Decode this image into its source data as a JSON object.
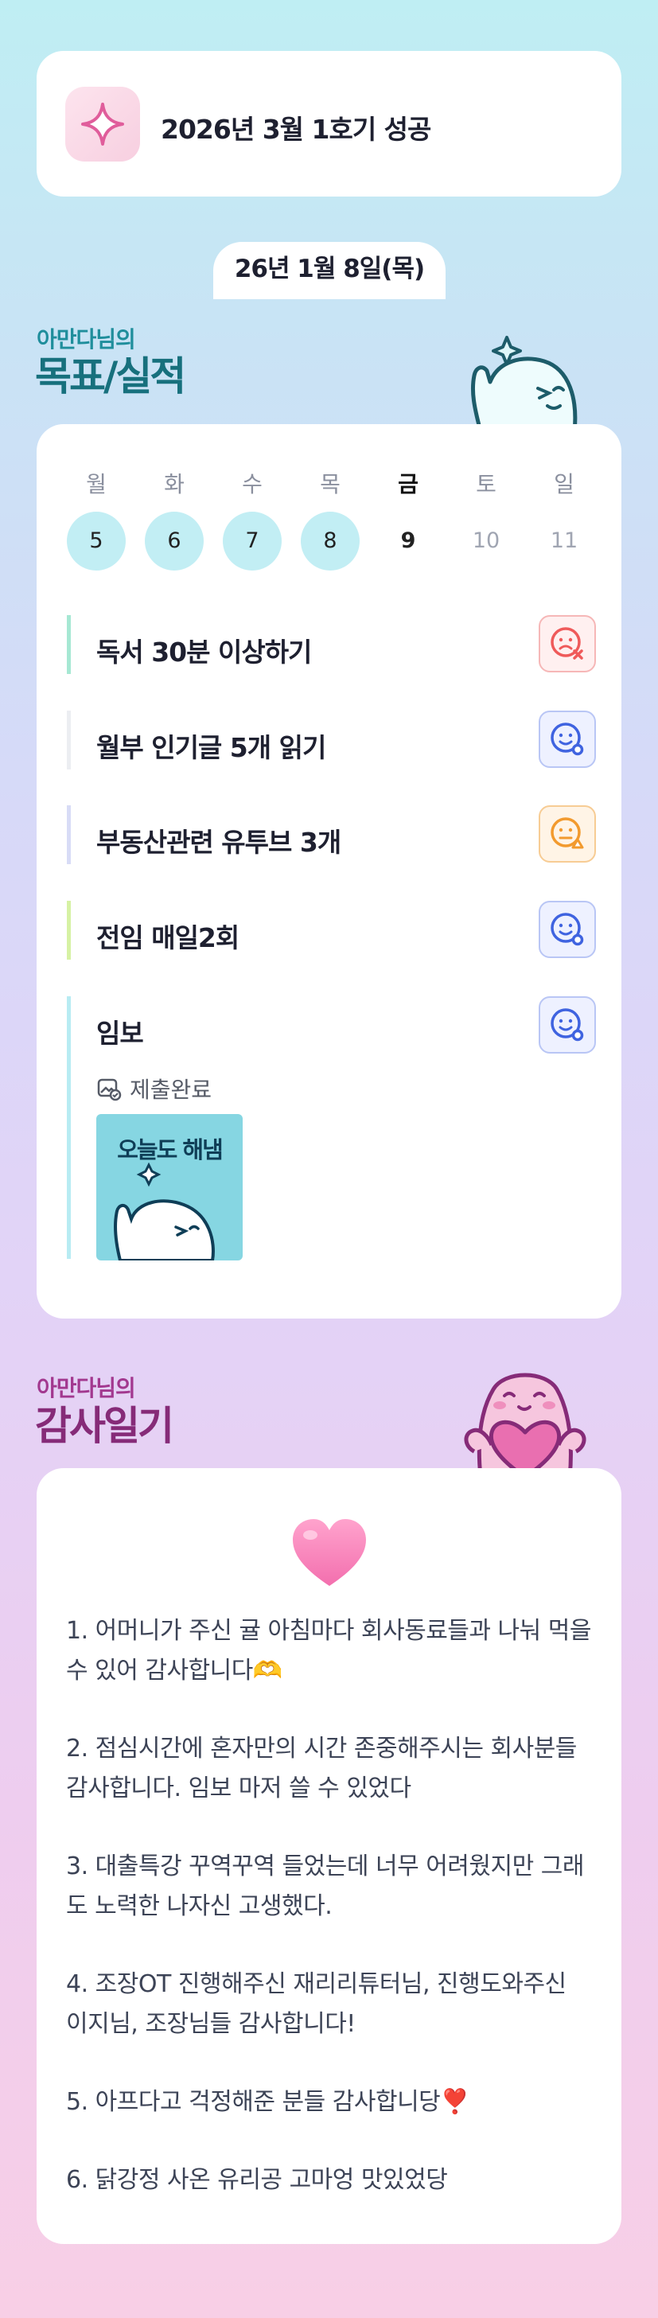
{
  "header": {
    "title": "2026년 3월 1호기 성공",
    "icon": "sparkle-icon"
  },
  "date_label": "26년 1월 8일(목)",
  "goals": {
    "owner_label": "아만다님의",
    "title": "목표/실적",
    "week": [
      {
        "label": "월",
        "num": "5",
        "state": "done"
      },
      {
        "label": "화",
        "num": "6",
        "state": "done"
      },
      {
        "label": "수",
        "num": "7",
        "state": "done"
      },
      {
        "label": "목",
        "num": "8",
        "state": "done"
      },
      {
        "label": "금",
        "num": "9",
        "state": "today"
      },
      {
        "label": "토",
        "num": "10",
        "state": "future"
      },
      {
        "label": "일",
        "num": "11",
        "state": "future"
      }
    ],
    "tasks": [
      {
        "name": "독서 30분 이상하기",
        "status": "fail",
        "bar_color": "#a6e8d3"
      },
      {
        "name": "월부 인기글 5개 읽기",
        "status": "success",
        "bar_color": "#eceef2"
      },
      {
        "name": "부동산관련 유투브 3개",
        "status": "partial",
        "bar_color": "#d8dcf6"
      },
      {
        "name": "전임 매일2회",
        "status": "success",
        "bar_color": "#d6f2a4"
      },
      {
        "name": "임보",
        "status": "success",
        "bar_color": "#b8ecf3",
        "submitted_label": "제출완료",
        "proof_text": "오늘도 해냄"
      }
    ]
  },
  "diary": {
    "owner_label": "아만다님의",
    "title": "감사일기",
    "icon": "heart-icon",
    "entries": [
      "1. 어머니가 주신 귤 아침마다 회사동료들과 나눠 먹을 수 있어 감사합니다🫶",
      "2. 점심시간에 혼자만의 시간 존중해주시는 회사분들 감사합니다. 임보 마저 쓸 수 있었다",
      "3. 대출특강 꾸역꾸역 들었는데 너무 어려웠지만 그래도 노력한 나자신 고생했다.",
      "4. 조장OT 진행해주신 재리리튜터님, 진행도와주신 이지님, 조장님들 감사합니다!",
      "5. 아프다고 걱정해준 분들 감사합니당❣️",
      "6. 닭강정 사온 유리공 고마엉 맛있었당"
    ]
  },
  "colors": {
    "fail": "#ef5a5a",
    "success": "#3f63e0",
    "partial": "#f29a2e"
  }
}
